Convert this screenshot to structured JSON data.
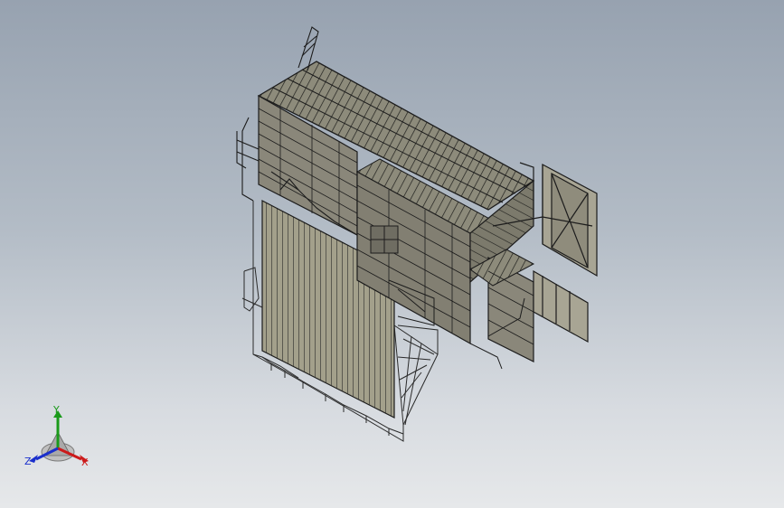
{
  "viewport": {
    "background_top": "#97a2b0",
    "background_bottom": "#e6e8ea",
    "model_fill": "#9d9a86",
    "model_line": "#1c1c1c"
  },
  "triad": {
    "x_label": "X",
    "y_label": "Y",
    "z_label": "Z",
    "x_color": "#cc1a1a",
    "y_color": "#1a9a1a",
    "z_color": "#1a2fcc"
  }
}
